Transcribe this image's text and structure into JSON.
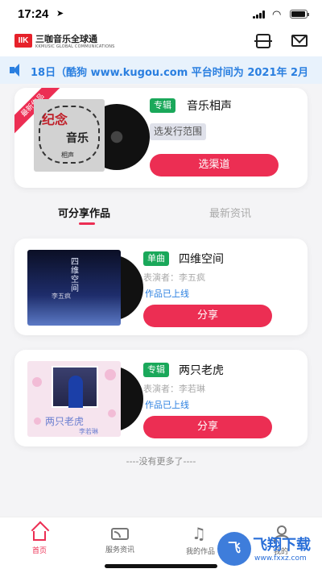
{
  "status_bar": {
    "time": "17:24",
    "location_icon": "location-arrow-icon",
    "icons": [
      "signal-icon",
      "wifi-icon",
      "battery-icon"
    ]
  },
  "header": {
    "logo_mark": "IIK",
    "brand_name": "三咖音乐全球通",
    "brand_sub": "KKMUSIC GLOBAL COMMUNICATIONS",
    "icons": [
      "scan-icon",
      "mail-icon"
    ]
  },
  "notice": {
    "icon": "speaker-icon",
    "text": "18日（酷狗 www.kugou.com 平台时间为 2021年 2月"
  },
  "featured": {
    "ribbon": "最新作品",
    "cover_text": [
      "纪念",
      "音乐",
      "相声"
    ],
    "tag": "专辑",
    "title": "音乐相声",
    "range_button": "选发行范围",
    "channel_button": "选渠道"
  },
  "tabs": [
    {
      "label": "可分享作品",
      "active": true
    },
    {
      "label": "最新资讯",
      "active": false
    }
  ],
  "works": [
    {
      "tag": "单曲",
      "title": "四维空间",
      "performer": "表演者：李五疯",
      "status": "作品已上线",
      "share": "分享",
      "cover_title": "四维空间",
      "cover_artist": "李五疯"
    },
    {
      "tag": "专辑",
      "title": "两只老虎",
      "performer": "表演者：李若琳",
      "status": "作品已上线",
      "share": "分享",
      "cover_title": "两只老虎",
      "cover_artist": "李若琳"
    }
  ],
  "list_end": "----没有更多了----",
  "bottom_nav": [
    {
      "label": "首页",
      "icon": "home-icon",
      "active": true
    },
    {
      "label": "服务资讯",
      "icon": "tv-icon",
      "active": false
    },
    {
      "label": "我的作品",
      "icon": "music-note-icon",
      "active": false
    },
    {
      "label": "我的",
      "icon": "user-icon",
      "active": false
    }
  ],
  "watermark": {
    "mark": "飞",
    "title": "飞翔下载",
    "url": "www.fxxz.com"
  },
  "colors": {
    "accent": "#ec2e53",
    "tag_green": "#1aa85a",
    "link_blue": "#2a7fe0",
    "notice_bg": "#e8f2fc"
  }
}
